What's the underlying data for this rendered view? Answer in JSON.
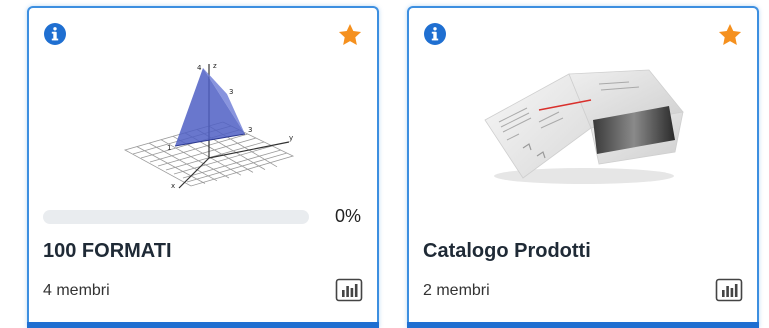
{
  "cards": [
    {
      "title": "100 FORMATI",
      "members": "4 membri",
      "progress_label": "0%",
      "progress_value": 0,
      "thumbnail": "3d-coordinate-graph",
      "icons": {
        "info": "info-icon",
        "favorite": "star-icon",
        "stats": "bar-chart-icon"
      },
      "graph_labels": {
        "z": "z",
        "y": "y",
        "x": "x",
        "v1": "4",
        "v2": "3",
        "v3": "3",
        "v4": "1"
      }
    },
    {
      "title": "Catalogo Prodotti",
      "members": "2 membri",
      "thumbnail": "open-catalog-brochure",
      "icons": {
        "info": "info-icon",
        "favorite": "star-icon",
        "stats": "bar-chart-icon"
      }
    }
  ],
  "colors": {
    "accent": "#1f6fd1",
    "card_border": "#3d8fe0",
    "star": "#f5901e",
    "info": "#1f6fd1"
  }
}
